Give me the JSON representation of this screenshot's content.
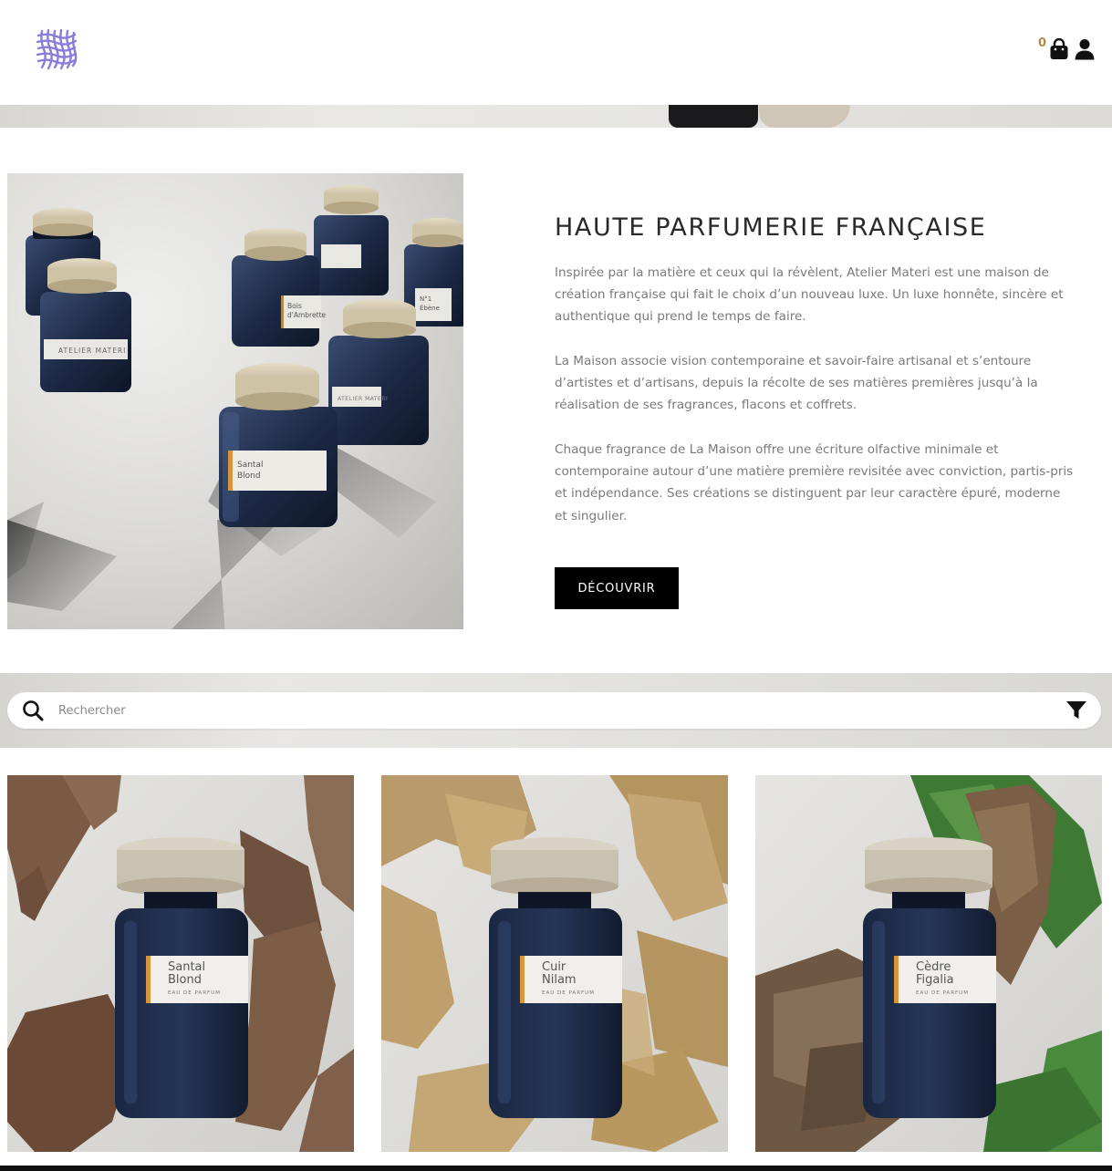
{
  "header": {
    "logo_icon": "atelier-materi-logo",
    "cart_count": "0",
    "cart_icon": "shopping-bag-icon",
    "account_icon": "user-icon"
  },
  "intro": {
    "title": "HAUTE PARFUMERIE FRANÇAISE",
    "paragraphs": [
      "Inspirée par la matière et ceux qui la révèlent, Atelier Materi est une maison de création française qui fait le choix d’un nouveau luxe. Un luxe honnête, sincère et authentique qui prend le temps de faire.",
      "La Maison associe vision contemporaine et savoir-faire artisanal et s’entoure d’artistes et d’artisans, depuis la récolte de ses matières premières jusqu’à la réalisation de ses fragrances, flacons et coffrets.",
      "Chaque fragrance de La Maison offre une écriture olfactive minimale et contemporaine autour d’une matière première revisitée avec conviction, partis-pris et indépendance. Ses créations se distinguent par leur caractère épuré, moderne et singulier."
    ],
    "button_label": "DÉCOUVRIR",
    "bottle_labels": [
      {
        "line1": "Santal",
        "line2": "Blond"
      },
      {
        "line1": "Bois",
        "line2": "d'Ambrette"
      },
      {
        "line1": "N°1",
        "line2": "Ébène"
      }
    ],
    "brand_label": "ATELIER MATERI"
  },
  "search": {
    "placeholder": "Rechercher",
    "value": "",
    "search_icon": "search-icon",
    "filter_icon": "filter-icon"
  },
  "products": [
    {
      "name_line1": "Santal",
      "name_line2": "Blond",
      "type": "EAU  DE  PARFUM"
    },
    {
      "name_line1": "Cuir",
      "name_line2": "Nilam",
      "type": "EAU  DE  PARFUM"
    },
    {
      "name_line1": "Cèdre",
      "name_line2": "Figalia",
      "type": "EAU  DE  PARFUM"
    }
  ],
  "colors": {
    "accent_gold": "#b08a4b",
    "bottle_blue": "#1b2a44",
    "button_bg": "#000000"
  }
}
